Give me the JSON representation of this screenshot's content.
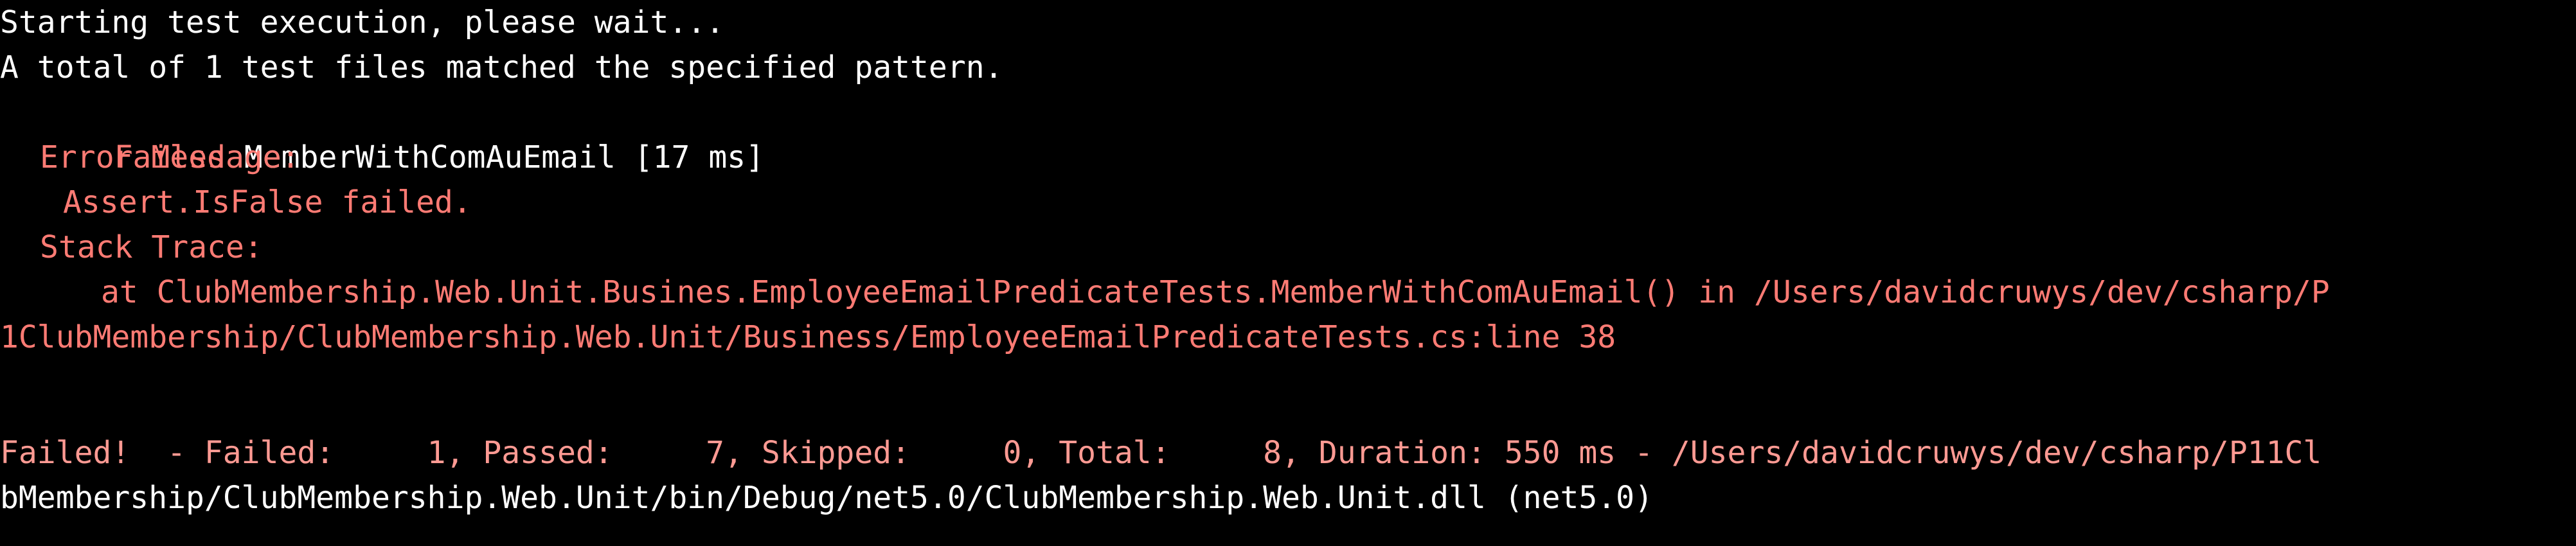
{
  "terminal": {
    "background": "#000000",
    "text_color": "#ffffff",
    "error_color": "#ff7b74",
    "status_color": "#ff9a93",
    "lines": [
      "Starting test execution, please wait...",
      "A total of 1 test files matched the specified pattern.",
      {
        "failed_label": "Failed",
        "test_name": " MemberWithComAuEmail [17 ms]"
      },
      "Error Message:",
      "Assert.IsFalse failed.",
      "Stack Trace:",
      "at ClubMembership.Web.Unit.Busines.EmployeeEmailPredicateTests.MemberWithComAuEmail() in /Users/davidcruwys/dev/csharp/P",
      "1ClubMembership/ClubMembership.Web.Unit/Business/EmployeeEmailPredicateTests.cs:line 38",
      "Failed!  - Failed:     1, Passed:     7, Skipped:     0, Total:     8, Duration: 550 ms - /Users/davidcruwys/dev/csharp/P11Cl",
      "bMembership/ClubMembership.Web.Unit/bin/Debug/net5.0/ClubMembership.Web.Unit.dll (net5.0)"
    ]
  }
}
